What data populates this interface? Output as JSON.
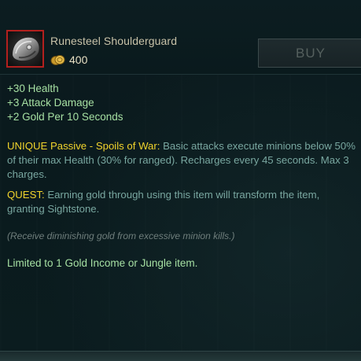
{
  "item": {
    "name": "Runesteel Shoulderguard",
    "cost": "400",
    "icon": "shoulderguard-icon",
    "icon_border_color": "#b3201e"
  },
  "buy_button": {
    "label": "BUY",
    "enabled": false
  },
  "stats": [
    "+30 Health",
    "+3 Attack Damage",
    "+2 Gold Per 10 Seconds"
  ],
  "passive": {
    "label": "UNIQUE Passive - Spoils of War:",
    "text": "Basic attacks execute minions below 50% of their max Health (30% for ranged). Recharges every 45 seconds. Max 3 charges."
  },
  "quest": {
    "label": "QUEST:",
    "text": "Earning gold through using this item will transform the item, granting Sightstone."
  },
  "note": "(Receive diminishing gold from excessive minion kills.)",
  "limit": "Limited to 1 Gold Income or Jungle item.",
  "colors": {
    "stat_text": "#a6e0a3",
    "keyword": "#f2d42c",
    "description": "#79a7a0",
    "item_name": "#c8c2a8"
  }
}
